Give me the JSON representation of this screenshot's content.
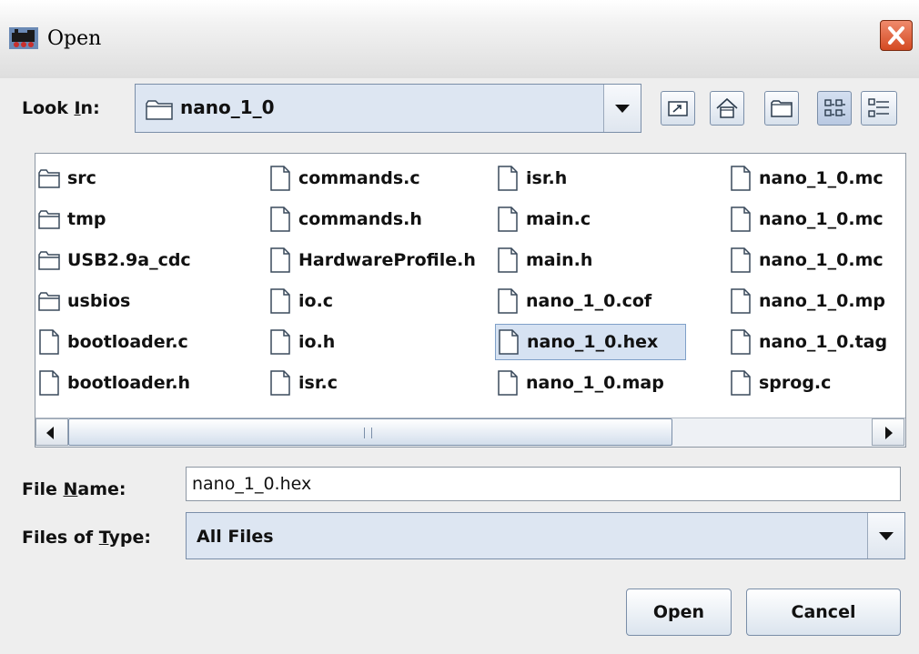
{
  "window": {
    "title": "Open",
    "app_icon": "locomotive-icon",
    "close_icon": "close-icon"
  },
  "look_in": {
    "label_before": "Look ",
    "label_mnemonic": "I",
    "label_after": "n:",
    "value": "nano_1_0",
    "value_icon": "folder-icon"
  },
  "toolbar": {
    "buttons": [
      {
        "name": "up-one-level-button",
        "icon": "up-folder-icon"
      },
      {
        "name": "home-button",
        "icon": "home-icon"
      },
      {
        "name": "new-folder-button",
        "icon": "new-folder-icon"
      },
      {
        "name": "list-view-button",
        "icon": "list-view-icon"
      },
      {
        "name": "details-view-button",
        "icon": "details-view-icon"
      }
    ]
  },
  "files": {
    "columns": [
      [
        {
          "name": "src",
          "type": "folder"
        },
        {
          "name": "tmp",
          "type": "folder"
        },
        {
          "name": "USB2.9a_cdc",
          "type": "folder"
        },
        {
          "name": "usbios",
          "type": "folder"
        },
        {
          "name": "bootloader.c",
          "type": "file"
        },
        {
          "name": "bootloader.h",
          "type": "file"
        }
      ],
      [
        {
          "name": "commands.c",
          "type": "file"
        },
        {
          "name": "commands.h",
          "type": "file"
        },
        {
          "name": "HardwareProfile.h",
          "type": "file"
        },
        {
          "name": "io.c",
          "type": "file"
        },
        {
          "name": "io.h",
          "type": "file"
        },
        {
          "name": "isr.c",
          "type": "file"
        }
      ],
      [
        {
          "name": "isr.h",
          "type": "file"
        },
        {
          "name": "main.c",
          "type": "file"
        },
        {
          "name": "main.h",
          "type": "file"
        },
        {
          "name": "nano_1_0.cof",
          "type": "file"
        },
        {
          "name": "nano_1_0.hex",
          "type": "file",
          "selected": true
        },
        {
          "name": "nano_1_0.map",
          "type": "file"
        }
      ],
      [
        {
          "name": "nano_1_0.mc",
          "type": "file"
        },
        {
          "name": "nano_1_0.mc",
          "type": "file"
        },
        {
          "name": "nano_1_0.mc",
          "type": "file"
        },
        {
          "name": "nano_1_0.mp",
          "type": "file"
        },
        {
          "name": "nano_1_0.tag",
          "type": "file"
        },
        {
          "name": "sprog.c",
          "type": "file"
        }
      ]
    ]
  },
  "file_name": {
    "label_before": "File ",
    "label_mnemonic": "N",
    "label_after": "ame:",
    "value": "nano_1_0.hex"
  },
  "file_type": {
    "label_before": "Files of ",
    "label_mnemonic": "T",
    "label_after": "ype:",
    "value": "All Files"
  },
  "buttons": {
    "open": "Open",
    "cancel": "Cancel"
  },
  "colors": {
    "selection": "#d6e2f2",
    "close_button": "#d44a22"
  }
}
